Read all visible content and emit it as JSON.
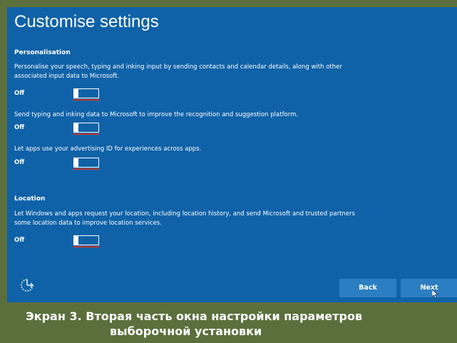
{
  "title": "Customise settings",
  "personalisation": {
    "heading": "Personalisation",
    "settings": [
      {
        "description": "Personalise your speech, typing and inking input by sending contacts and calendar details, along with other associated input data to Microsoft.",
        "state": "Off"
      },
      {
        "description": "Send typing and inking data to Microsoft to improve the recognition and suggestion platform.",
        "state": "Off"
      },
      {
        "description": "Let apps use your advertising ID for experiences across apps.",
        "state": "Off"
      }
    ]
  },
  "location": {
    "heading": "Location",
    "settings": [
      {
        "description": "Let Windows and apps request your location, including location history, and send Microsoft and trusted partners some location data to improve location services.",
        "state": "Off"
      }
    ]
  },
  "footer": {
    "ease_icon": "ease-of-access-icon",
    "back_label": "Back",
    "next_label": "Next"
  },
  "caption": {
    "line1": "Экран 3. Вторая часть окна настройки параметров",
    "line2": "выборочной установки"
  },
  "colors": {
    "background": "#0f62a8",
    "frame": "#5b6f3c",
    "button": "#2c7ec2"
  }
}
